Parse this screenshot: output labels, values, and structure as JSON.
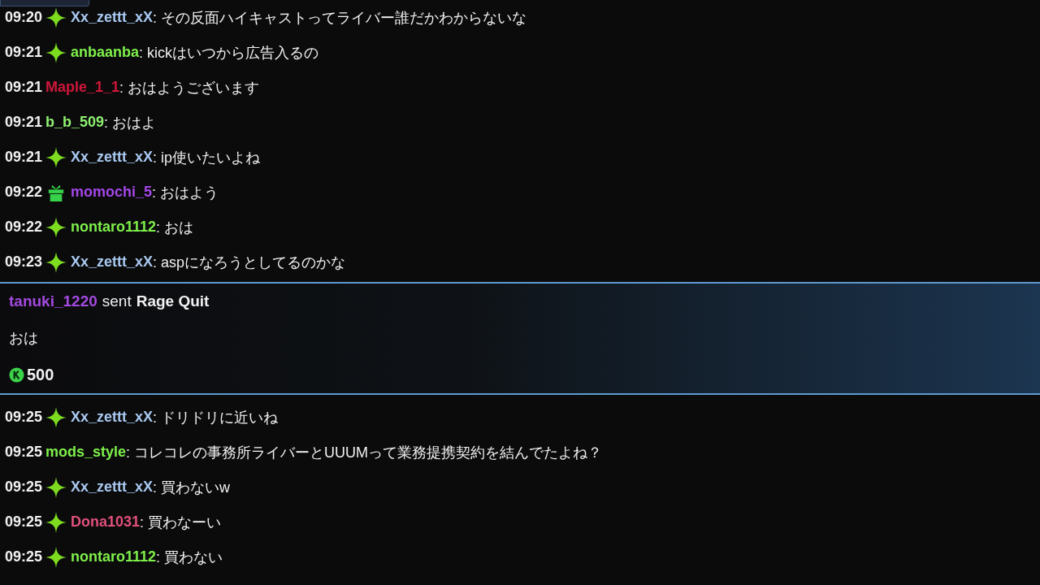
{
  "messages_before": [
    {
      "time": "09:20",
      "kind": "diamond",
      "user": "Xx_zettt_xX",
      "color": "#a8c8f0",
      "text": ": その反面ハイキャストってライバー誰だかわからないな"
    },
    {
      "time": "09:21",
      "kind": "diamond",
      "user": "anbaanba",
      "color": "#7ef04a",
      "text": ": kickはいつから広告入るの"
    },
    {
      "time": "09:21",
      "kind": "plain",
      "user": "Maple_1_1",
      "color": "#d0173a",
      "text": ": おはようございます"
    },
    {
      "time": "09:21",
      "kind": "plain",
      "user": "b_b_509",
      "color": "#8ef070",
      "text": ": おはよ"
    },
    {
      "time": "09:21",
      "kind": "diamond",
      "user": "Xx_zettt_xX",
      "color": "#a8c8f0",
      "text": ": ip使いたいよね"
    },
    {
      "time": "09:22",
      "kind": "gift",
      "user": "momochi_5",
      "color": "#a347e8",
      "text": ": おはよう"
    },
    {
      "time": "09:22",
      "kind": "diamond",
      "user": "nontaro1112",
      "color": "#7ef04a",
      "text": ": おは"
    },
    {
      "time": "09:23",
      "kind": "diamond",
      "user": "Xx_zettt_xX",
      "color": "#a8c8f0",
      "text": ": aspになろうとしてるのかな"
    }
  ],
  "gift": {
    "user": "tanuki_1220",
    "verb": "sent",
    "item": "Rage Quit",
    "message": "おは",
    "amount": "500"
  },
  "messages_after": [
    {
      "time": "09:25",
      "kind": "diamond",
      "user": "Xx_zettt_xX",
      "color": "#a8c8f0",
      "text": ": ドリドリに近いね"
    },
    {
      "time": "09:25",
      "kind": "plain",
      "user": "mods_style",
      "color": "#7ef04a",
      "text": ": コレコレの事務所ライバーとUUUMって業務提携契約を結んでたよね？"
    },
    {
      "time": "09:25",
      "kind": "diamond",
      "user": "Xx_zettt_xX",
      "color": "#a8c8f0",
      "text": ": 買わないw"
    },
    {
      "time": "09:25",
      "kind": "diamond",
      "user": "Dona1031",
      "color": "#e0507a",
      "text": ": 買わなーい"
    },
    {
      "time": "09:25",
      "kind": "diamond",
      "user": "nontaro1112",
      "color": "#7ef04a",
      "text": ": 買わない"
    }
  ]
}
